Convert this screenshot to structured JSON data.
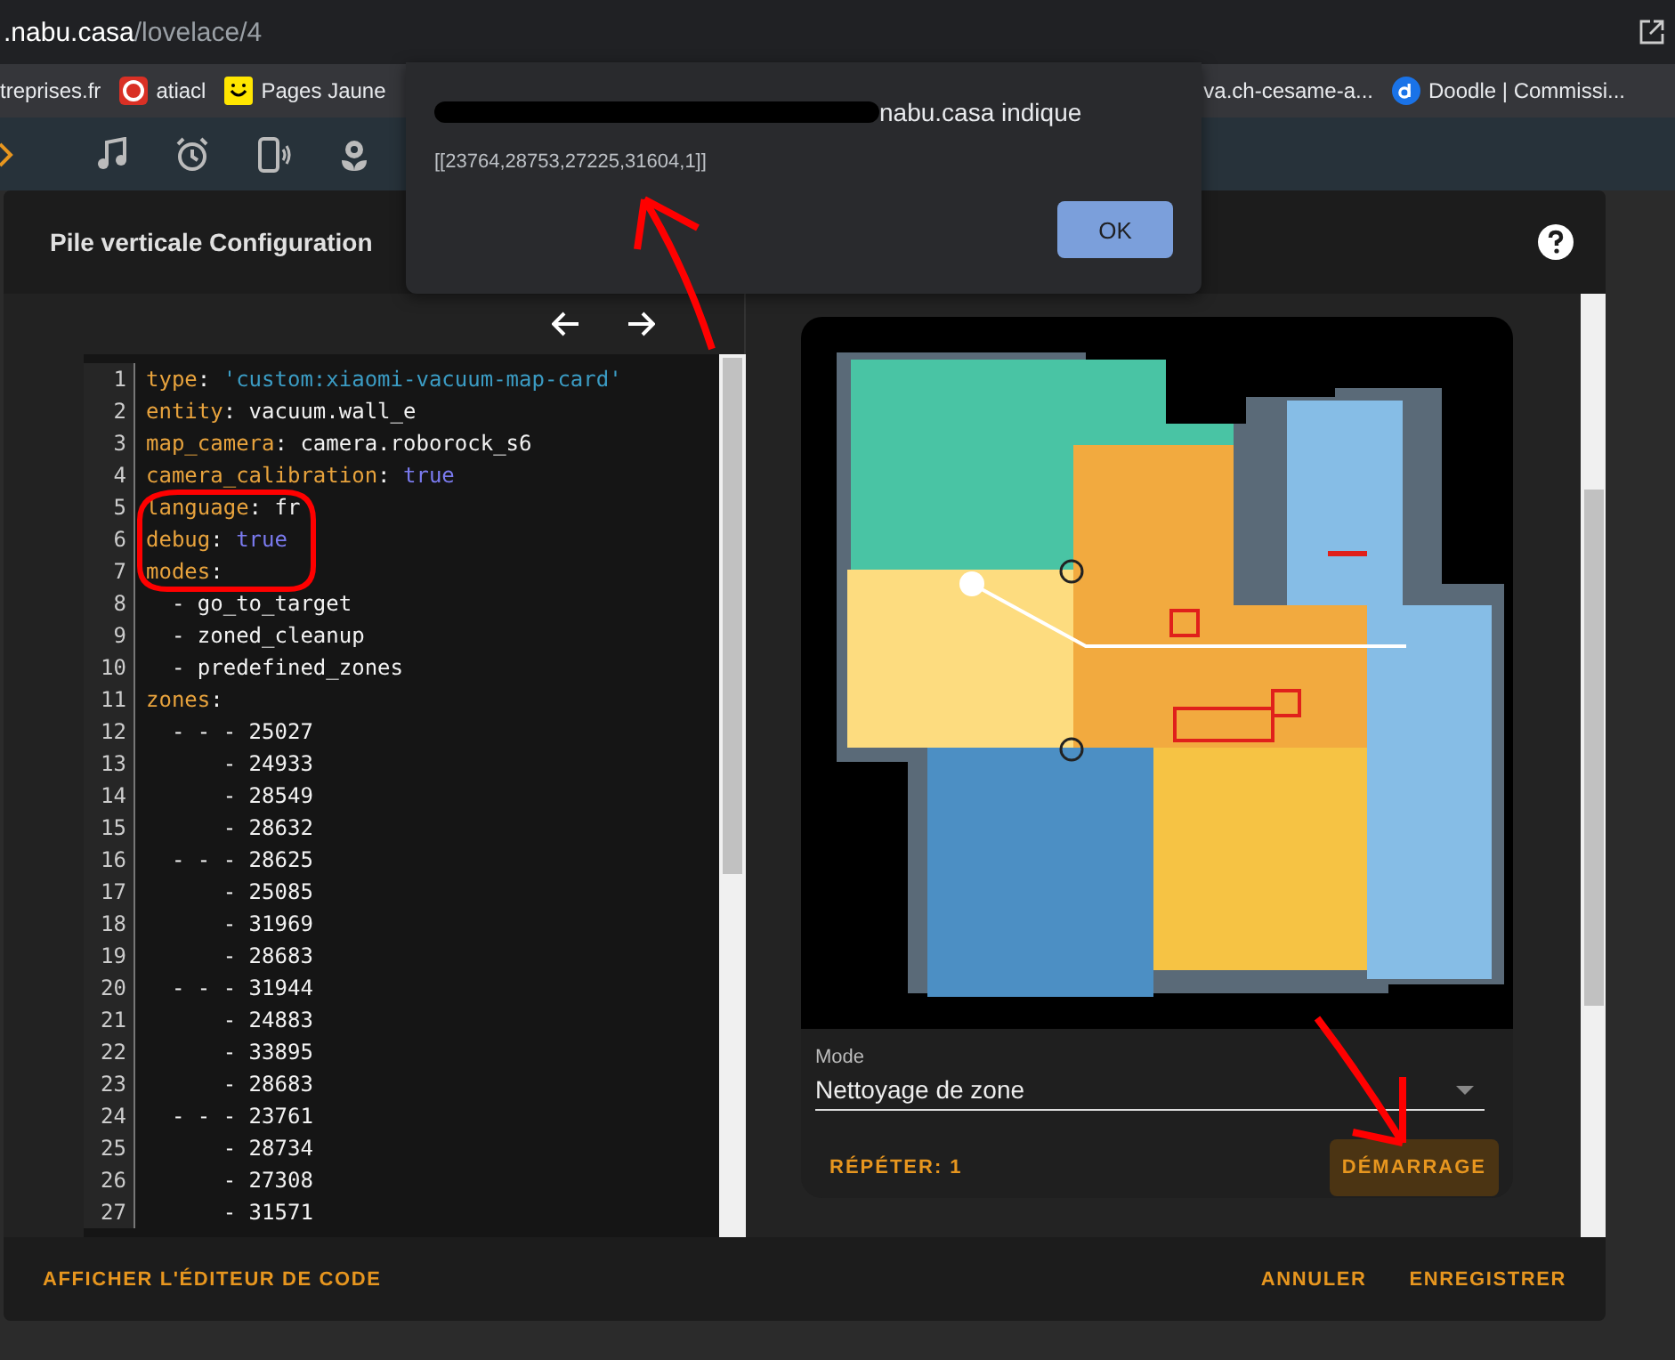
{
  "browser": {
    "url_host": ".nabu.casa",
    "url_path": "/lovelace/4"
  },
  "bookmarks": [
    {
      "label": "treprises.fr"
    },
    {
      "label": "atiacl"
    },
    {
      "label": "Pages Jaune"
    },
    {
      "label": "va.ch-cesame-a..."
    },
    {
      "label": "Doodle | Commissi..."
    }
  ],
  "alert": {
    "title": "nabu.casa indique",
    "message": "[[23764,28753,27225,31604,1]]",
    "button": "OK"
  },
  "dialog": {
    "title": "Pile verticale Configuration",
    "code_lines": [
      {
        "number": "1",
        "tokens": [
          {
            "kind": "key",
            "text": "type"
          },
          {
            "kind": "plain",
            "text": ": "
          },
          {
            "kind": "string",
            "text": "'custom:xiaomi-vacuum-map-card'"
          }
        ]
      },
      {
        "number": "2",
        "tokens": [
          {
            "kind": "key",
            "text": "entity"
          },
          {
            "kind": "plain",
            "text": ": vacuum.wall_e"
          }
        ]
      },
      {
        "number": "3",
        "tokens": [
          {
            "kind": "key",
            "text": "map_camera"
          },
          {
            "kind": "plain",
            "text": ": camera.roborock_s6"
          }
        ]
      },
      {
        "number": "4",
        "tokens": [
          {
            "kind": "key",
            "text": "camera_calibration"
          },
          {
            "kind": "plain",
            "text": ": "
          },
          {
            "kind": "bool",
            "text": "true"
          }
        ]
      },
      {
        "number": "5",
        "tokens": [
          {
            "kind": "key",
            "text": "language"
          },
          {
            "kind": "plain",
            "text": ": fr"
          }
        ]
      },
      {
        "number": "6",
        "tokens": [
          {
            "kind": "key",
            "text": "debug"
          },
          {
            "kind": "plain",
            "text": ": "
          },
          {
            "kind": "bool",
            "text": "true"
          }
        ]
      },
      {
        "number": "7",
        "tokens": [
          {
            "kind": "key",
            "text": "modes"
          },
          {
            "kind": "plain",
            "text": ":"
          }
        ]
      },
      {
        "number": "8",
        "tokens": [
          {
            "kind": "plain",
            "text": "  - go_to_target"
          }
        ]
      },
      {
        "number": "9",
        "tokens": [
          {
            "kind": "plain",
            "text": "  - zoned_cleanup"
          }
        ]
      },
      {
        "number": "10",
        "tokens": [
          {
            "kind": "plain",
            "text": "  - predefined_zones"
          }
        ]
      },
      {
        "number": "11",
        "tokens": [
          {
            "kind": "key",
            "text": "zones"
          },
          {
            "kind": "plain",
            "text": ":"
          }
        ]
      },
      {
        "number": "12",
        "tokens": [
          {
            "kind": "plain",
            "text": "  - - - 25027"
          }
        ]
      },
      {
        "number": "13",
        "tokens": [
          {
            "kind": "plain",
            "text": "      - 24933"
          }
        ]
      },
      {
        "number": "14",
        "tokens": [
          {
            "kind": "plain",
            "text": "      - 28549"
          }
        ]
      },
      {
        "number": "15",
        "tokens": [
          {
            "kind": "plain",
            "text": "      - 28632"
          }
        ]
      },
      {
        "number": "16",
        "tokens": [
          {
            "kind": "plain",
            "text": "  - - - 28625"
          }
        ]
      },
      {
        "number": "17",
        "tokens": [
          {
            "kind": "plain",
            "text": "      - 25085"
          }
        ]
      },
      {
        "number": "18",
        "tokens": [
          {
            "kind": "plain",
            "text": "      - 31969"
          }
        ]
      },
      {
        "number": "19",
        "tokens": [
          {
            "kind": "plain",
            "text": "      - 28683"
          }
        ]
      },
      {
        "number": "20",
        "tokens": [
          {
            "kind": "plain",
            "text": "  - - - 31944"
          }
        ]
      },
      {
        "number": "21",
        "tokens": [
          {
            "kind": "plain",
            "text": "      - 24883"
          }
        ]
      },
      {
        "number": "22",
        "tokens": [
          {
            "kind": "plain",
            "text": "      - 33895"
          }
        ]
      },
      {
        "number": "23",
        "tokens": [
          {
            "kind": "plain",
            "text": "      - 28683"
          }
        ]
      },
      {
        "number": "24",
        "tokens": [
          {
            "kind": "plain",
            "text": "  - - - 23761"
          }
        ]
      },
      {
        "number": "25",
        "tokens": [
          {
            "kind": "plain",
            "text": "      - 28734"
          }
        ]
      },
      {
        "number": "26",
        "tokens": [
          {
            "kind": "plain",
            "text": "      - 27308"
          }
        ]
      },
      {
        "number": "27",
        "tokens": [
          {
            "kind": "plain",
            "text": "      - 31571"
          }
        ]
      }
    ],
    "preview": {
      "mode_label": "Mode",
      "mode_value": "Nettoyage de zone",
      "repeat_button": "RÉPÉTER: 1",
      "start_button": "DÉMARRAGE"
    },
    "footer": {
      "code_editor_button": "AFFICHER L'ÉDITEUR DE CODE",
      "cancel_button": "ANNULER",
      "save_button": "ENREGISTRER"
    }
  }
}
